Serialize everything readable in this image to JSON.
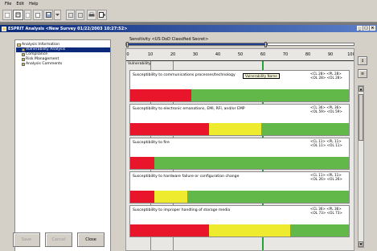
{
  "menubar": {
    "items": [
      "File",
      "Edit",
      "Help"
    ]
  },
  "titlebar": {
    "title": "ESPRIT Analysis  <New Survey 01/22/2003 10:27:52>"
  },
  "tree": {
    "items": [
      {
        "label": "Analysis Information",
        "type": "folder"
      },
      {
        "label": "Vulnerability Analysis",
        "type": "leaf",
        "selected": true
      },
      {
        "label": "Compliance",
        "type": "leaf"
      },
      {
        "label": "Risk Management",
        "type": "leaf"
      },
      {
        "label": "Analysis Comments",
        "type": "leaf"
      }
    ]
  },
  "buttons": {
    "save": "Save",
    "cancel": "Cancel",
    "close": "Close"
  },
  "sensitivity": {
    "label": "Sensitivity <US DoD Classified Secret>"
  },
  "scale": {
    "ticks": [
      "0",
      "10",
      "20",
      "30",
      "40",
      "50",
      "60",
      "70",
      "80",
      "90",
      "100"
    ],
    "axis_label": "Vulnerability"
  },
  "tooltip": {
    "text": "Vulnerability Name"
  },
  "risks": [
    {
      "title": "Susceptibility to communications processes/technology",
      "vals": [
        "<CL 28> <PL 28>",
        "<OL 28> <OL 28>"
      ],
      "red": 28,
      "yellow": 0
    },
    {
      "title": "Susceptibility to electronic emanations, EMI, RFI, and/or EMP",
      "vals": [
        "<CL 36> <PL 36>",
        "<OL 59> <OL 59>"
      ],
      "red": 36,
      "yellow": 24
    },
    {
      "title": "Susceptibility to fire",
      "vals": [
        "<CL 11> <PL 11>",
        "<OL 11> <OL 11>"
      ],
      "red": 11,
      "yellow": 0
    },
    {
      "title": "Susceptibility to hardware failure or configuration change",
      "vals": [
        "<CL 11> <PL 11>",
        "<OL 26> <OL 26>"
      ],
      "red": 11,
      "yellow": 15
    },
    {
      "title": "Susceptibility to improper handling of storage media",
      "vals": [
        "<CL 36> <PL 36>",
        "<OL 73> <OL 73>"
      ],
      "red": 36,
      "yellow": 37
    }
  ],
  "scrollbar": {
    "up": "▲",
    "down": "▼"
  },
  "side_buttons": [
    "↕",
    "≡"
  ]
}
